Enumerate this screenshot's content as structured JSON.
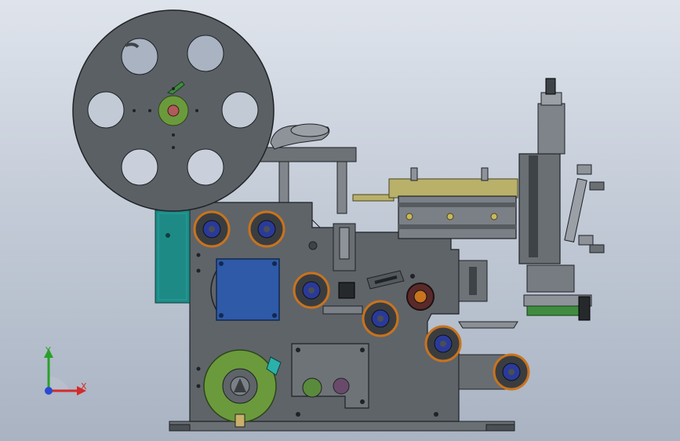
{
  "viewport": {
    "background_top": "#dfe4ec",
    "background_bottom": "#a9b3c2"
  },
  "model": {
    "body_color": "#5f6469",
    "edge_color": "#1f2226",
    "roller_ring_color": "#c8731e",
    "roller_core_color": "#2a3a9a",
    "cyan_panel_color": "#1e8a86",
    "blue_motor_color": "#2e5aa8",
    "green_hub_color": "#6b9a3c",
    "brass_rod_color": "#b9b06a"
  },
  "triad": {
    "x_label": "X",
    "y_label": "Y",
    "x_color": "#d42a2a",
    "y_color": "#2aa02a",
    "z_color": "#2a4ad4"
  }
}
